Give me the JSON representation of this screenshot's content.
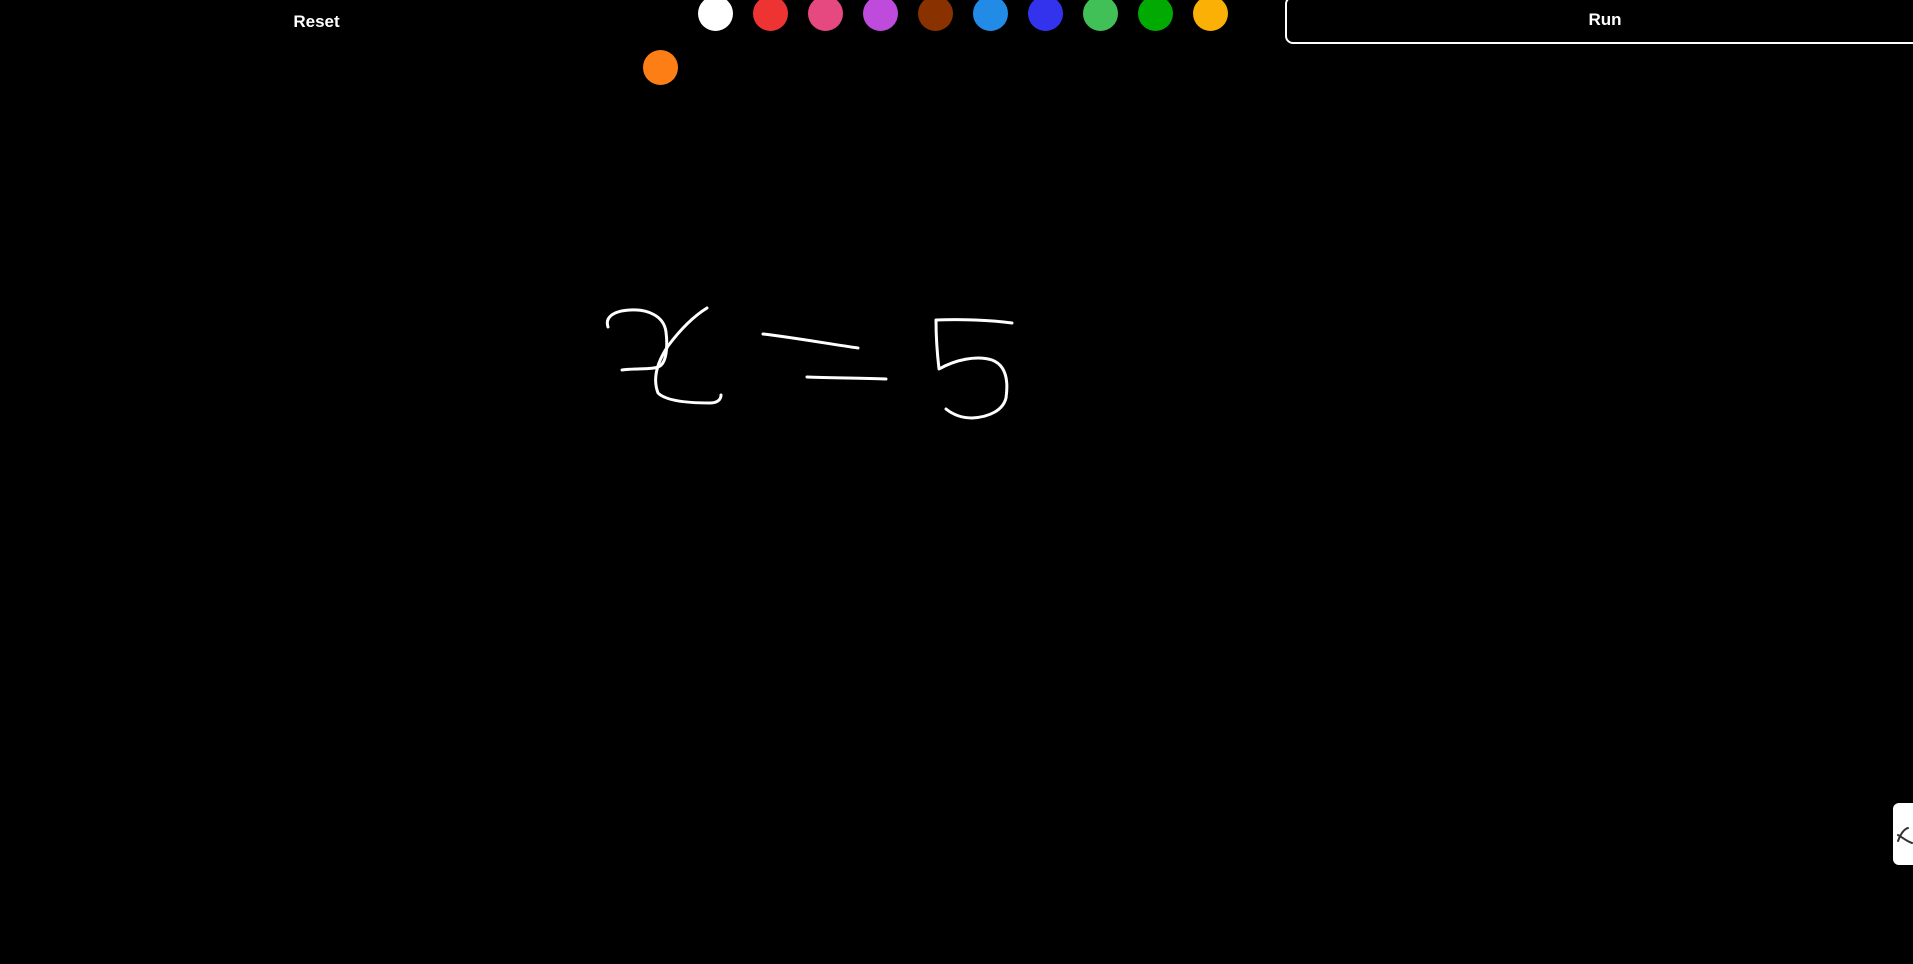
{
  "toolbar": {
    "reset_label": "Reset",
    "run_label": "Run"
  },
  "palette": {
    "colors": [
      {
        "name": "black",
        "hex": "#000000"
      },
      {
        "name": "white",
        "hex": "#ffffff"
      },
      {
        "name": "red",
        "hex": "#ee3333"
      },
      {
        "name": "pink",
        "hex": "#e64980"
      },
      {
        "name": "purple",
        "hex": "#be4bdb"
      },
      {
        "name": "brown",
        "hex": "#893200"
      },
      {
        "name": "light-blue",
        "hex": "#228be6"
      },
      {
        "name": "blue",
        "hex": "#3333ee"
      },
      {
        "name": "light-green",
        "hex": "#40c057"
      },
      {
        "name": "green",
        "hex": "#00aa00"
      },
      {
        "name": "yellow-orange",
        "hex": "#fab005"
      },
      {
        "name": "orange",
        "hex": "#fd7e14"
      }
    ]
  },
  "canvas": {
    "background": "#000000",
    "stroke_color": "#ffffff"
  },
  "side_handle": {
    "icon": "scribble-icon"
  }
}
